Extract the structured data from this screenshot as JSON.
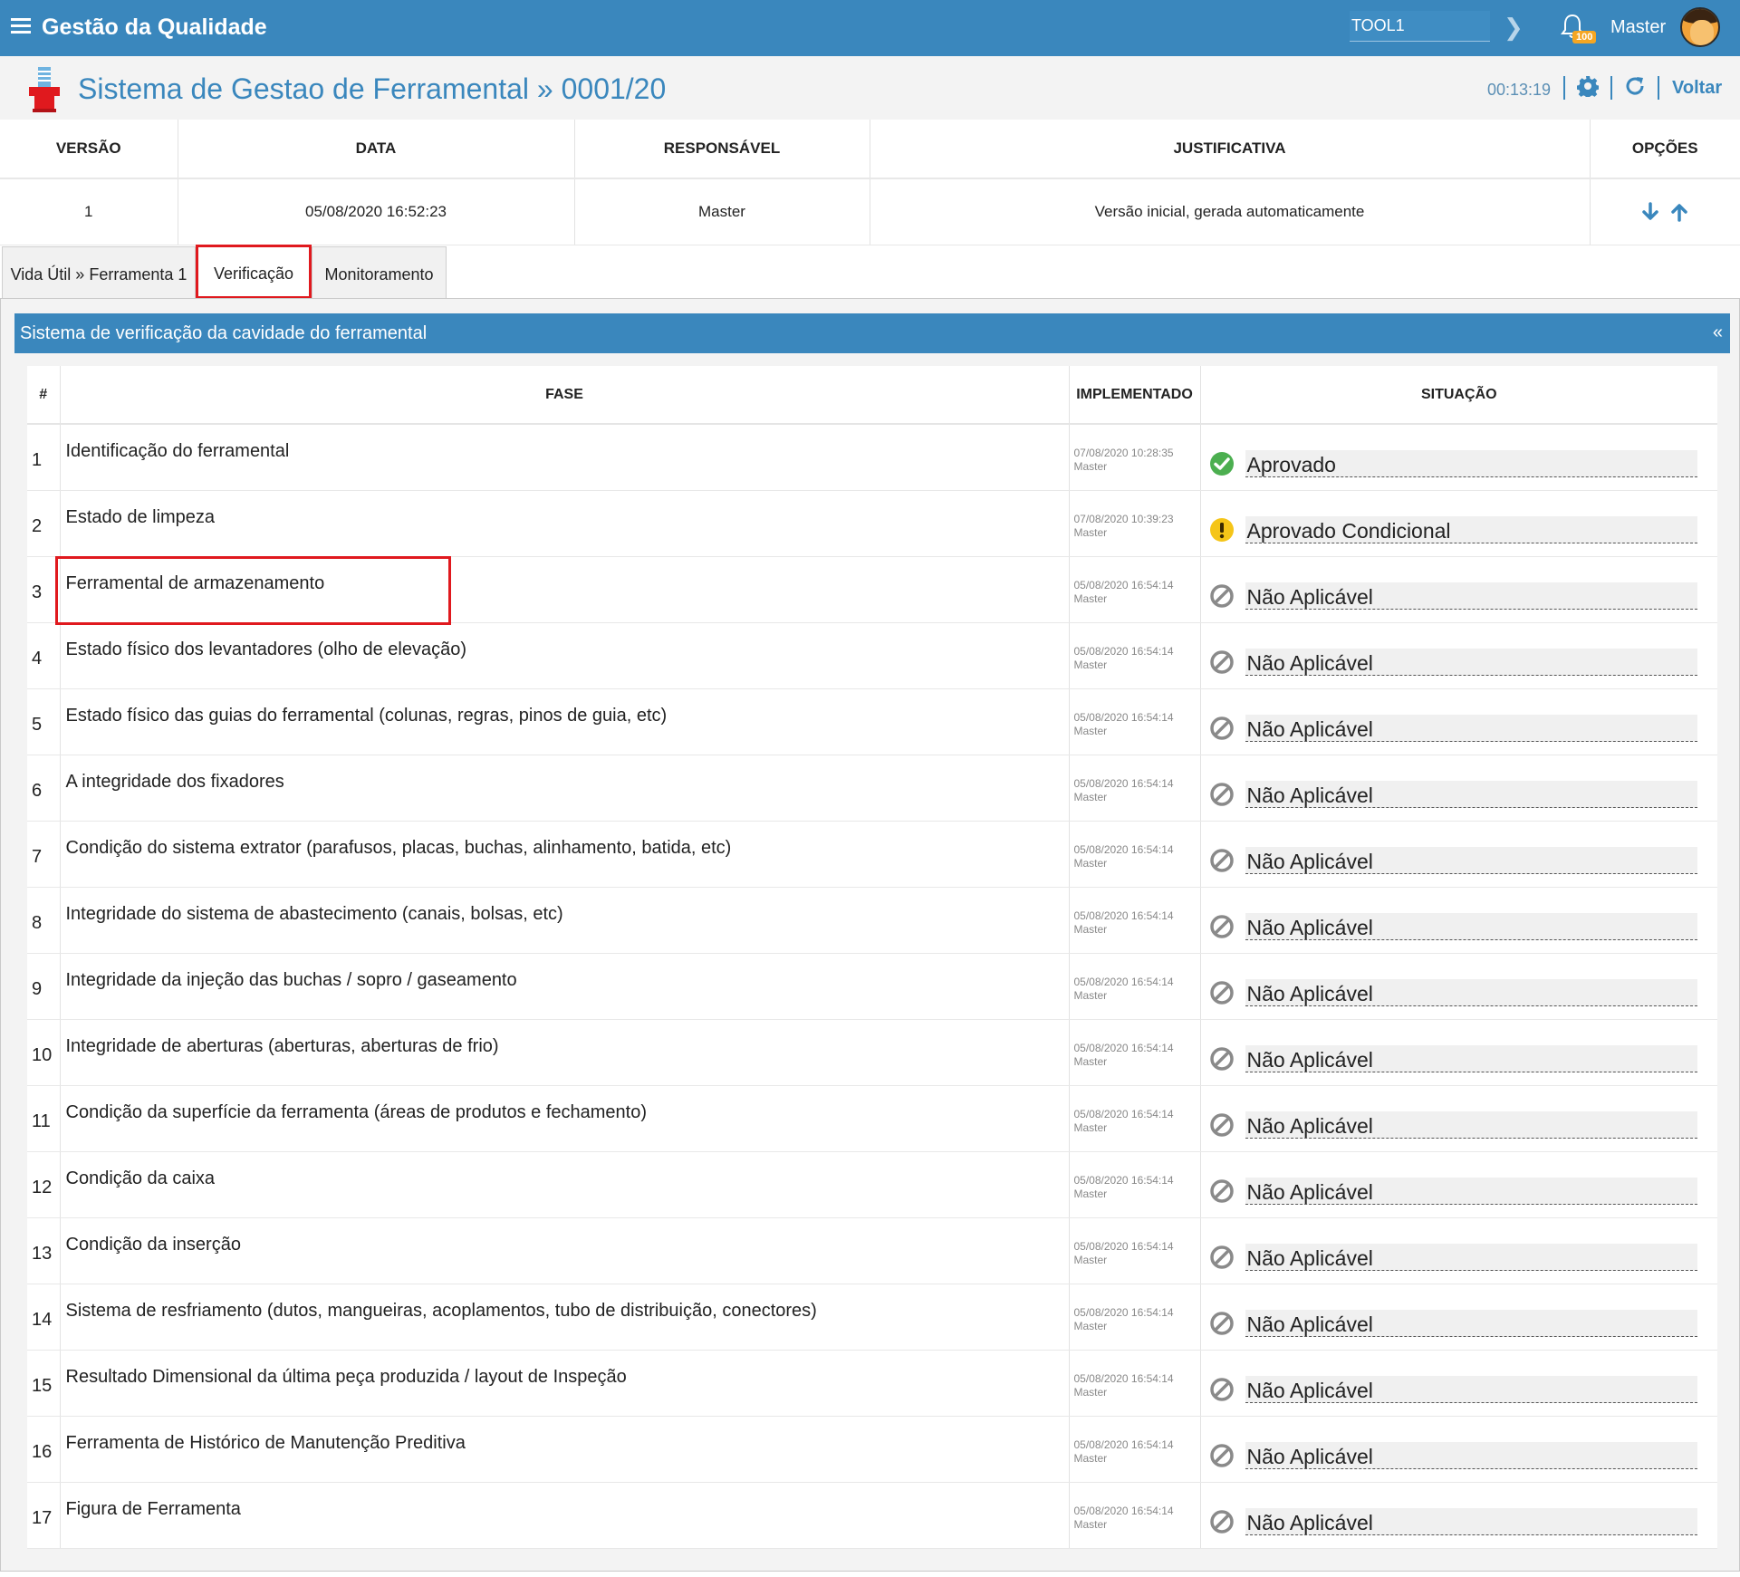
{
  "topbar": {
    "app_title": "Gestão da Qualidade",
    "tool_value": "TOOL1",
    "notification_count": "100",
    "user_name": "Master"
  },
  "header": {
    "title": "Sistema de Gestao de Ferramental » 0001/20",
    "timer": "00:13:19",
    "back_label": "Voltar"
  },
  "versions": {
    "columns": [
      "VERSÃO",
      "DATA",
      "RESPONSÁVEL",
      "JUSTIFICATIVA",
      "OPÇÕES"
    ],
    "rows": [
      {
        "version": "1",
        "date": "05/08/2020 16:52:23",
        "responsible": "Master",
        "justification": "Versão inicial, gerada automaticamente"
      }
    ]
  },
  "tabs": [
    {
      "label": "Vida Útil » Ferramenta 1"
    },
    {
      "label": "Verificação"
    },
    {
      "label": "Monitoramento"
    }
  ],
  "panel": {
    "title": "Sistema de verificação da cavidade do ferramental",
    "collapse_symbol": "«",
    "columns": [
      "#",
      "FASE",
      "IMPLEMENTADO",
      "SITUAÇÃO"
    ],
    "rows": [
      {
        "num": "1",
        "fase": "Identificação do ferramental",
        "date": "07/08/2020 10:28:35",
        "user": "Master",
        "status": "Aprovado",
        "status_icon": "check-circle-icon"
      },
      {
        "num": "2",
        "fase": "Estado de limpeza",
        "date": "07/08/2020 10:39:23",
        "user": "Master",
        "status": "Aprovado Condicional",
        "status_icon": "warning-circle-icon"
      },
      {
        "num": "3",
        "fase": "Ferramental de armazenamento",
        "date": "05/08/2020 16:54:14",
        "user": "Master",
        "status": "Não Aplicável",
        "status_icon": "ban-icon"
      },
      {
        "num": "4",
        "fase": "Estado físico dos levantadores (olho de elevação)",
        "date": "05/08/2020 16:54:14",
        "user": "Master",
        "status": "Não Aplicável",
        "status_icon": "ban-icon"
      },
      {
        "num": "5",
        "fase": "Estado físico das guias do ferramental (colunas, regras, pinos de guia, etc)",
        "date": "05/08/2020 16:54:14",
        "user": "Master",
        "status": "Não Aplicável",
        "status_icon": "ban-icon"
      },
      {
        "num": "6",
        "fase": "A integridade dos fixadores",
        "date": "05/08/2020 16:54:14",
        "user": "Master",
        "status": "Não Aplicável",
        "status_icon": "ban-icon"
      },
      {
        "num": "7",
        "fase": "Condição do sistema extrator (parafusos, placas, buchas, alinhamento, batida, etc)",
        "date": "05/08/2020 16:54:14",
        "user": "Master",
        "status": "Não Aplicável",
        "status_icon": "ban-icon"
      },
      {
        "num": "8",
        "fase": "Integridade do sistema de abastecimento (canais, bolsas, etc)",
        "date": "05/08/2020 16:54:14",
        "user": "Master",
        "status": "Não Aplicável",
        "status_icon": "ban-icon"
      },
      {
        "num": "9",
        "fase": "Integridade da injeção das buchas / sopro / gaseamento",
        "date": "05/08/2020 16:54:14",
        "user": "Master",
        "status": "Não Aplicável",
        "status_icon": "ban-icon"
      },
      {
        "num": "10",
        "fase": "Integridade de aberturas (aberturas, aberturas de frio)",
        "date": "05/08/2020 16:54:14",
        "user": "Master",
        "status": "Não Aplicável",
        "status_icon": "ban-icon"
      },
      {
        "num": "11",
        "fase": "Condição da superfície da ferramenta (áreas de produtos e fechamento)",
        "date": "05/08/2020 16:54:14",
        "user": "Master",
        "status": "Não Aplicável",
        "status_icon": "ban-icon"
      },
      {
        "num": "12",
        "fase": "Condição da caixa",
        "date": "05/08/2020 16:54:14",
        "user": "Master",
        "status": "Não Aplicável",
        "status_icon": "ban-icon"
      },
      {
        "num": "13",
        "fase": "Condição da inserção",
        "date": "05/08/2020 16:54:14",
        "user": "Master",
        "status": "Não Aplicável",
        "status_icon": "ban-icon"
      },
      {
        "num": "14",
        "fase": "Sistema de resfriamento (dutos, mangueiras, acoplamentos, tubo de distribuição, conectores)",
        "date": "05/08/2020 16:54:14",
        "user": "Master",
        "status": "Não Aplicável",
        "status_icon": "ban-icon"
      },
      {
        "num": "15",
        "fase": "Resultado Dimensional da última peça produzida / layout de Inspeção",
        "date": "05/08/2020 16:54:14",
        "user": "Master",
        "status": "Não Aplicável",
        "status_icon": "ban-icon"
      },
      {
        "num": "16",
        "fase": "Ferramenta de Histórico de Manutenção Preditiva",
        "date": "05/08/2020 16:54:14",
        "user": "Master",
        "status": "Não Aplicável",
        "status_icon": "ban-icon"
      },
      {
        "num": "17",
        "fase": "Figura de Ferramenta",
        "date": "05/08/2020 16:54:14",
        "user": "Master",
        "status": "Não Aplicável",
        "status_icon": "ban-icon"
      }
    ]
  },
  "colors": {
    "primary": "#3a87bd",
    "highlight": "#e0191e",
    "approved": "#4caf50",
    "conditional": "#f5c518",
    "not_applicable": "#8a8a8a"
  }
}
